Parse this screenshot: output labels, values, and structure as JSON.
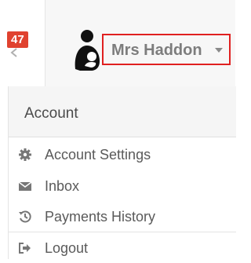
{
  "header": {
    "notification_count": "47",
    "user_name": "Mrs Haddon"
  },
  "menu": {
    "section_title": "Account",
    "items": [
      {
        "label": "Account Settings",
        "icon": "gear-icon"
      },
      {
        "label": "Inbox",
        "icon": "envelope-icon"
      },
      {
        "label": "Payments History",
        "icon": "history-icon"
      },
      {
        "label": "Logout",
        "icon": "sign-out-icon"
      }
    ]
  },
  "colors": {
    "badge": "#e0422f",
    "highlight_border": "#e02020",
    "user_name_text": "#7d7d7d"
  }
}
